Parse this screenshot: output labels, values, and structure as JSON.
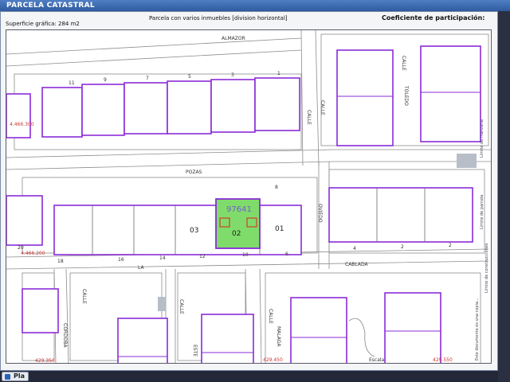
{
  "window": {
    "title": "PARCELA CATASTRAL"
  },
  "info": {
    "surface": "Superficie gráfica: 284 m2",
    "description": "Parcela con varios inmuebles [division horizontal]",
    "coefficient": "Coeficiente de participación:"
  },
  "map": {
    "streets": [
      "ALMAZOR",
      "CALLE",
      "TOLEDO",
      "CALLE",
      "POZAS",
      "OVIEDO",
      "CALLE",
      "CABLADA",
      "LA",
      "CALLE",
      "CORDOBA",
      "CALLE",
      "CALLE",
      "MALAGA",
      "ESTE",
      "Escala"
    ],
    "block_numbers_top": [
      "11",
      "9",
      "7",
      "5",
      "3",
      "1"
    ],
    "block_numbers_mid": [
      "20",
      "18",
      "16",
      "14",
      "12",
      "10",
      "8",
      "6",
      "4",
      "2",
      "2"
    ],
    "parcel": {
      "id": "97641",
      "units": [
        "03",
        "02",
        "01"
      ]
    },
    "coords": [
      "4.466.300",
      "4.466.200",
      "429.350",
      "429.450",
      "429.550"
    ],
    "side_legend": [
      "Límite de manzana",
      "Límite de parcela",
      "Límite de construcciones",
      "Límite de parcela",
      "Este documento es una copia..."
    ],
    "colors": {
      "parcel_line": "#8a2bd8",
      "selected_fill": "#7fdc6a",
      "street_line": "#7a7a7a",
      "coord_text": "#cc3333"
    }
  },
  "bottom": {
    "button_label": "Pla"
  }
}
